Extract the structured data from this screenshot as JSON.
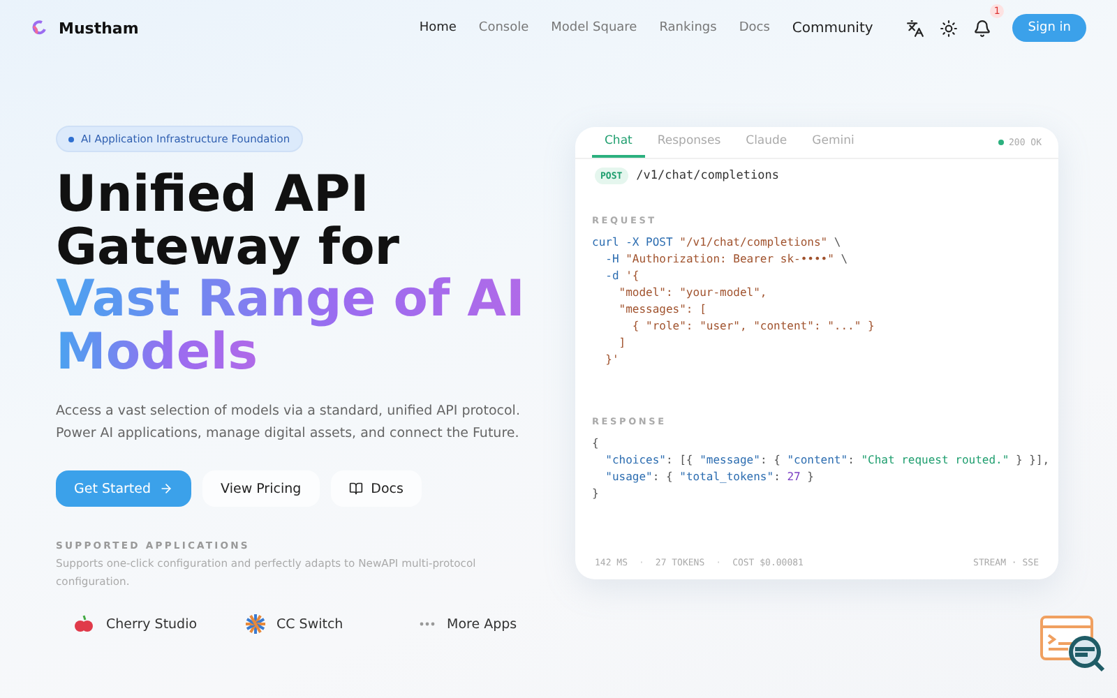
{
  "nav": {
    "brand": "Mustham",
    "links": [
      {
        "label": "Home",
        "selected": true
      },
      {
        "label": "Console",
        "selected": false
      },
      {
        "label": "Model Square",
        "selected": false
      },
      {
        "label": "Rankings",
        "selected": false
      },
      {
        "label": "Docs",
        "selected": false
      }
    ],
    "community": "Community",
    "notification_count": "1",
    "sign_in": "Sign in"
  },
  "hero": {
    "badge": "AI Application Infrastructure Foundation",
    "title_lines": [
      "Unified API",
      "Gateway for"
    ],
    "gradient_lines": [
      "Vast Range of AI",
      "Models"
    ],
    "description": "Access a vast selection of models via a standard, unified API protocol. Power AI applications, manage digital assets, and connect the Future.",
    "buttons": [
      {
        "label": "Get Started",
        "kind": "primary"
      },
      {
        "label": "View Pricing",
        "kind": "plain"
      },
      {
        "label": "Docs",
        "kind": "docs"
      }
    ],
    "apps_heading": "SUPPORTED APPLICATIONS",
    "apps_text": "Supports one-click configuration and perfectly adapts to NewAPI multi-protocol configuration.",
    "apps": [
      {
        "label": "Cherry Studio",
        "kind": "cherry"
      },
      {
        "label": "CC Switch",
        "kind": "burst"
      },
      {
        "label": "More Apps",
        "kind": "more"
      }
    ]
  },
  "card": {
    "tabs": [
      {
        "label": "Chat",
        "selected": true
      },
      {
        "label": "Responses",
        "selected": false
      },
      {
        "label": "Claude",
        "selected": false
      },
      {
        "label": "Gemini",
        "selected": false
      }
    ],
    "status": "200 OK",
    "method": "POST",
    "endpoint": "/v1/chat/completions",
    "request_label": "REQUEST",
    "request": [
      [
        {
          "kind": "cmd",
          "text": "curl "
        },
        {
          "kind": "flag",
          "text": "-X "
        },
        {
          "kind": "cmd",
          "text": "POST "
        },
        {
          "kind": "str",
          "text": "\"/v1/chat/completions\""
        },
        {
          "kind": "plain",
          "text": " \\"
        }
      ],
      [
        {
          "kind": "flag",
          "text": "  -H "
        },
        {
          "kind": "str",
          "text": "\"Authorization: Bearer sk-••••\""
        },
        {
          "kind": "plain",
          "text": " \\"
        }
      ],
      [
        {
          "kind": "flag",
          "text": "  -d "
        },
        {
          "kind": "str",
          "text": "'{"
        }
      ],
      [
        {
          "kind": "str",
          "text": "    \"model\": \"your-model\","
        }
      ],
      [
        {
          "kind": "str",
          "text": "    \"messages\": ["
        }
      ],
      [
        {
          "kind": "str",
          "text": "      { \"role\": \"user\", \"content\": \"...\" }"
        }
      ],
      [
        {
          "kind": "str",
          "text": "    ]"
        }
      ],
      [
        {
          "kind": "str",
          "text": "  }'"
        }
      ]
    ],
    "response_label": "RESPONSE",
    "response": [
      [
        {
          "kind": "plain",
          "text": "{"
        }
      ],
      [
        {
          "kind": "key",
          "text": "  \"choices\""
        },
        {
          "kind": "plain",
          "text": ": [{ "
        },
        {
          "kind": "key",
          "text": "\"message\""
        },
        {
          "kind": "plain",
          "text": ": { "
        },
        {
          "kind": "key",
          "text": "\"content\""
        },
        {
          "kind": "plain",
          "text": ": "
        },
        {
          "kind": "val",
          "text": "\"Chat request routed.\""
        },
        {
          "kind": "plain",
          "text": " } }],"
        }
      ],
      [
        {
          "kind": "key",
          "text": "  \"usage\""
        },
        {
          "kind": "plain",
          "text": ": { "
        },
        {
          "kind": "key",
          "text": "\"total_tokens\""
        },
        {
          "kind": "plain",
          "text": ": "
        },
        {
          "kind": "num",
          "text": "27"
        },
        {
          "kind": "plain",
          "text": " }"
        }
      ],
      [
        {
          "kind": "plain",
          "text": "}"
        }
      ]
    ],
    "stats": [
      "142 MS",
      "·",
      "27 TOKENS",
      "·",
      "COST $0.00081"
    ],
    "stream": "STREAM · SSE"
  }
}
